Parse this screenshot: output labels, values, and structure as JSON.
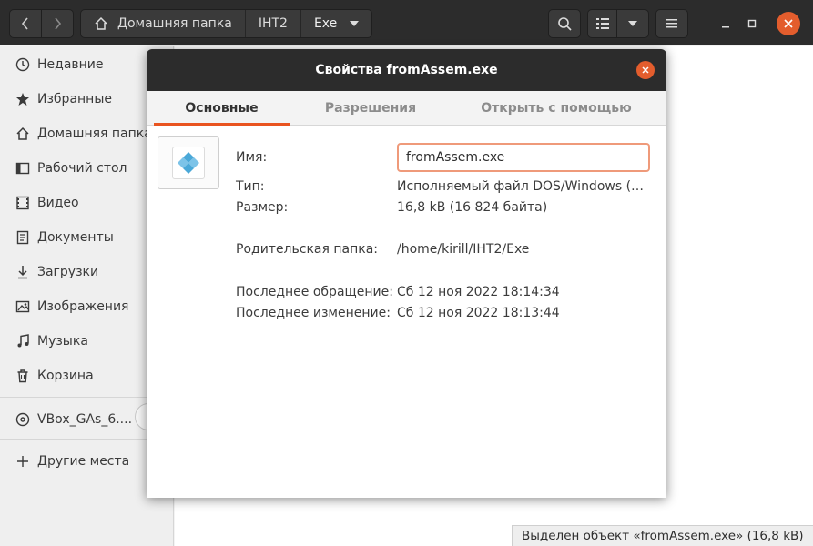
{
  "header": {
    "breadcrumbs": [
      "Домашняя папка",
      "IHT2",
      "Exe"
    ]
  },
  "sidebar": {
    "items": [
      {
        "label": "Недавние",
        "icon": "clock-icon"
      },
      {
        "label": "Избранные",
        "icon": "star-icon"
      },
      {
        "label": "Домашняя папка",
        "icon": "home-icon"
      },
      {
        "label": "Рабочий стол",
        "icon": "desktop-icon"
      },
      {
        "label": "Видео",
        "icon": "video-icon"
      },
      {
        "label": "Документы",
        "icon": "document-icon"
      },
      {
        "label": "Загрузки",
        "icon": "download-icon"
      },
      {
        "label": "Изображения",
        "icon": "image-icon"
      },
      {
        "label": "Музыка",
        "icon": "music-icon"
      },
      {
        "label": "Корзина",
        "icon": "trash-icon"
      }
    ],
    "device": {
      "label": "VBox_GAs_6....",
      "icon": "disc-icon"
    },
    "other": {
      "label": "Другие места",
      "icon": "plus-icon"
    }
  },
  "statusbar": {
    "text": "Выделен объект «fromAssem.exe»  (16,8 kB)"
  },
  "dialog": {
    "title": "Свойства fromAssem.exe",
    "tabs": [
      "Основные",
      "Разрешения",
      "Открыть с помощью"
    ],
    "active_tab": "Основные",
    "fields": {
      "name_label": "Имя:",
      "name_value": "fromAssem.exe",
      "type_label": "Тип:",
      "type_value": "Исполняемый файл DOS/Windows (a…",
      "size_label": "Размер:",
      "size_value": "16,8 kB (16 824 байта)",
      "parent_label": "Родительская папка:",
      "parent_value": "/home/kirill/IHT2/Exe",
      "accessed_label": "Последнее обращение:",
      "accessed_value": "Сб 12 ноя 2022 18:14:34",
      "modified_label": "Последнее изменение:",
      "modified_value": "Сб 12 ноя 2022 18:13:44"
    }
  },
  "colors": {
    "accent": "#e95420",
    "close_button": "#e35d2d",
    "headerbar": "#2c2c2c"
  }
}
